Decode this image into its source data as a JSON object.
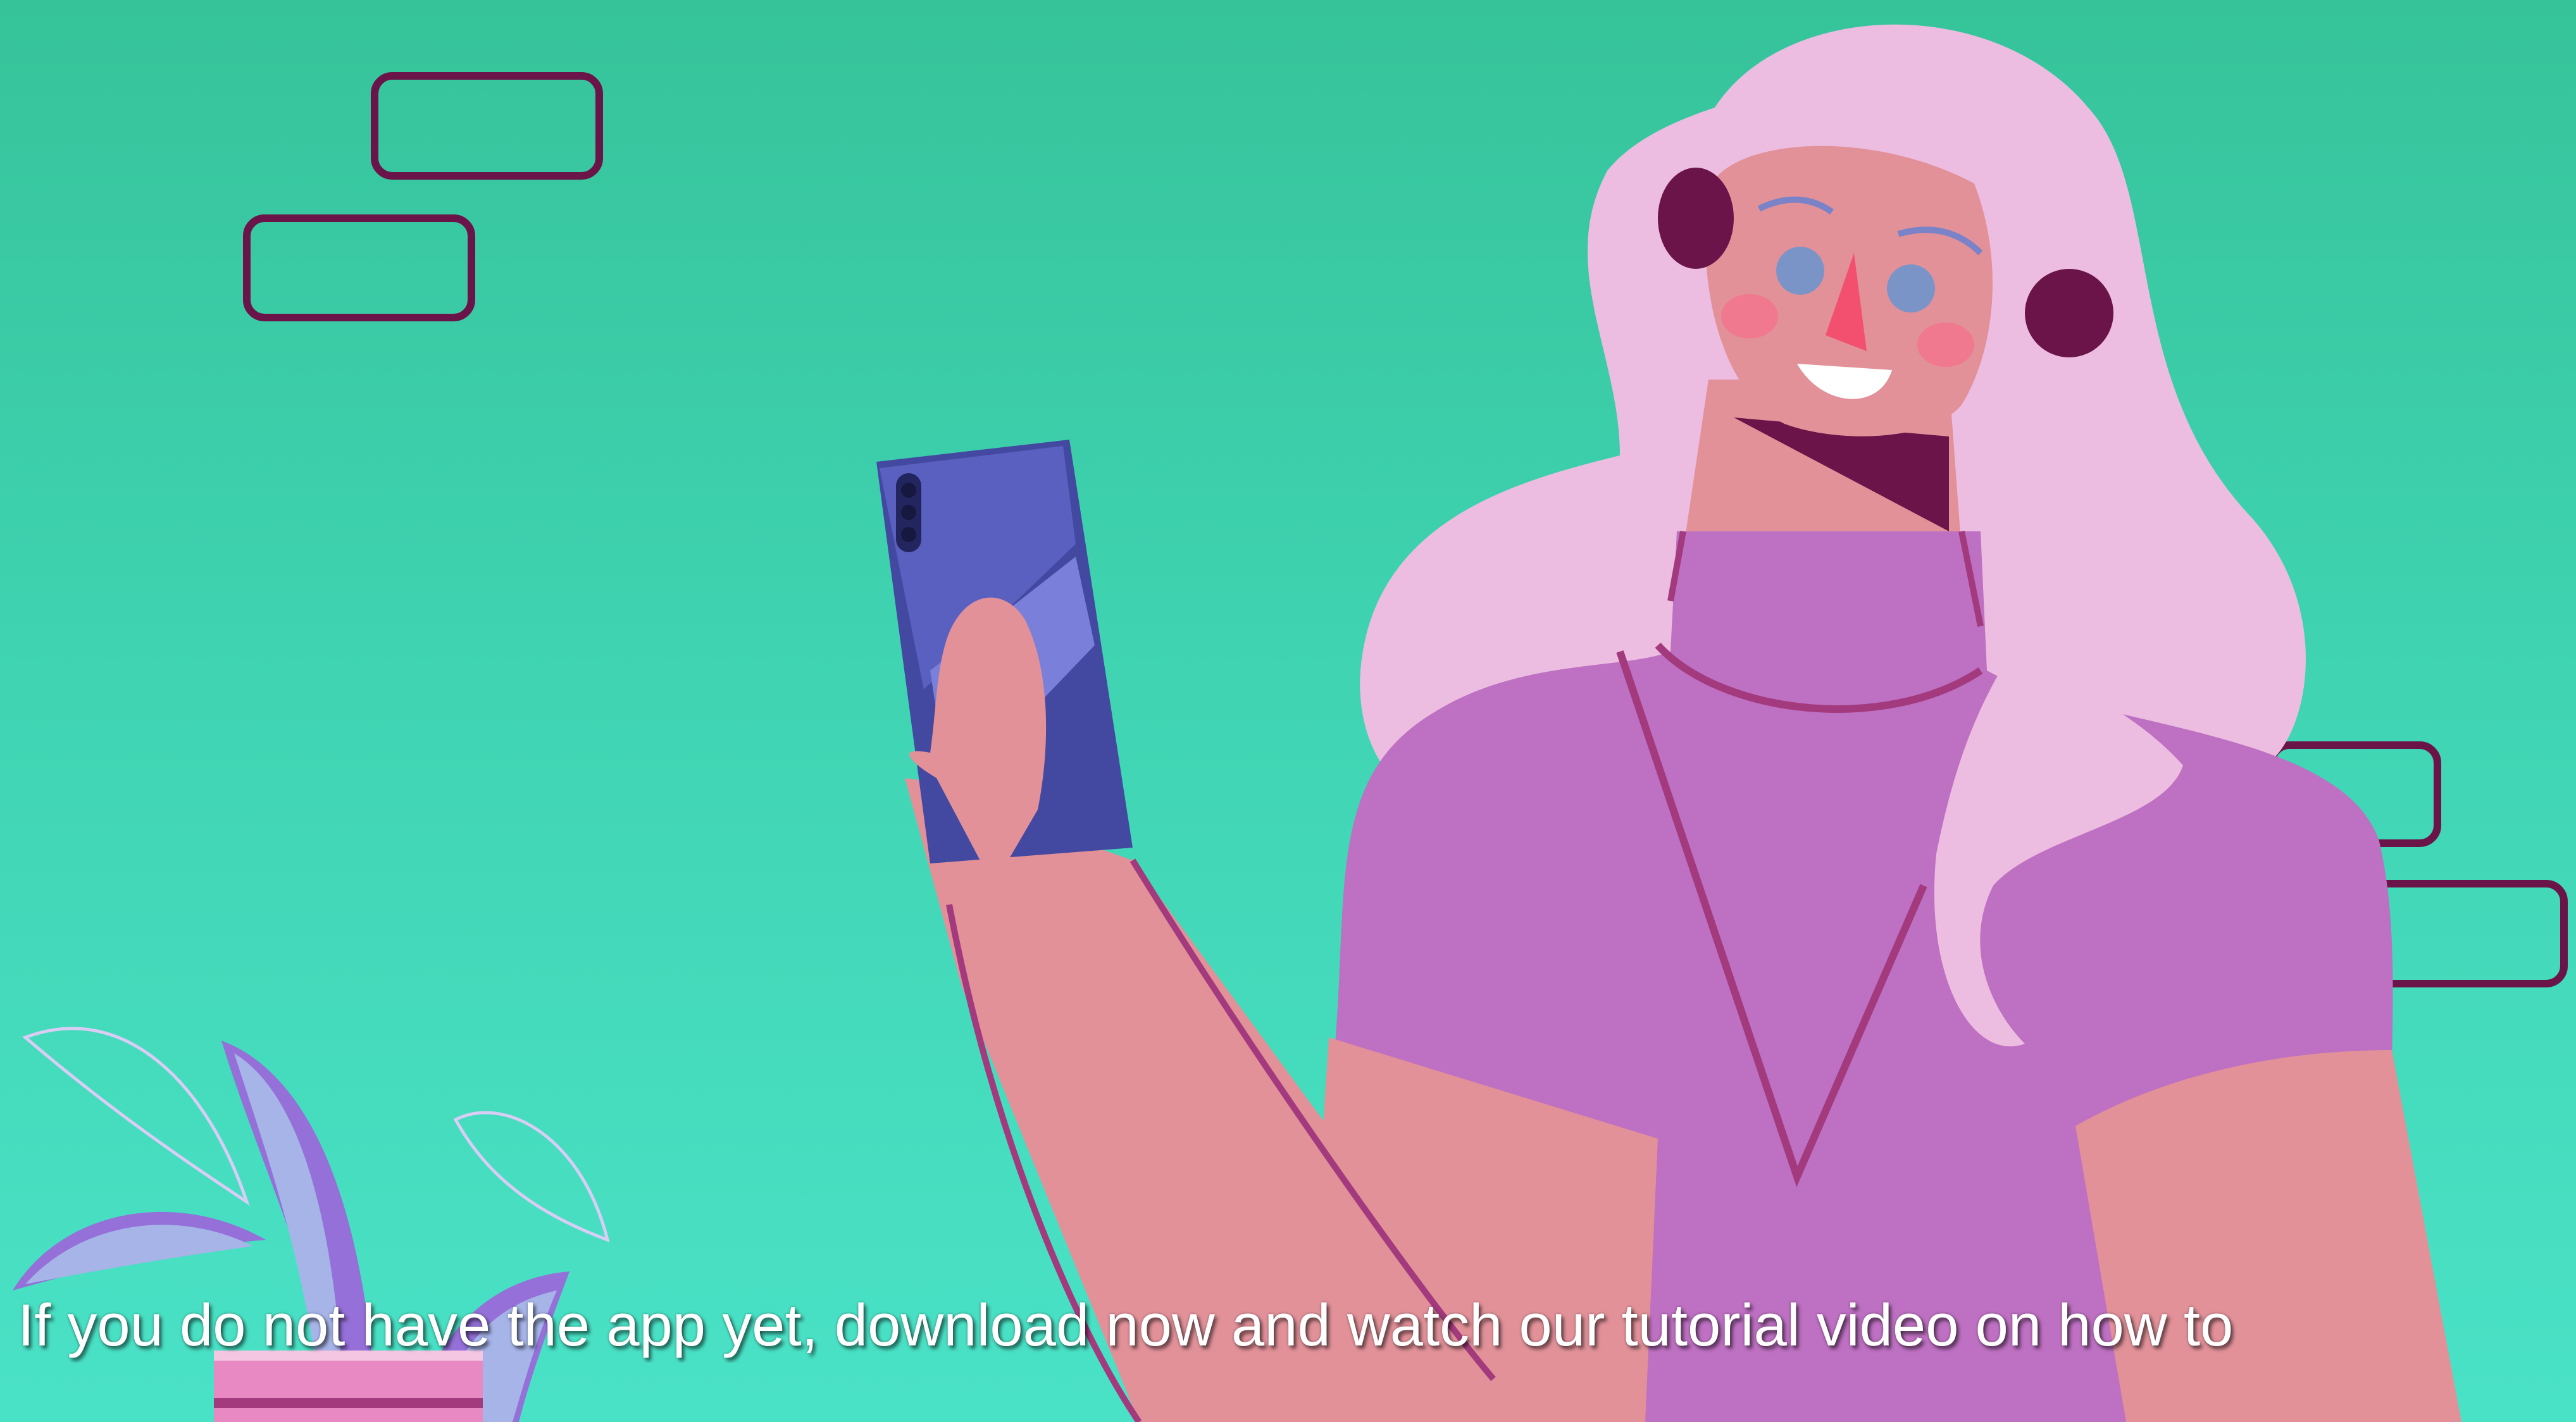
{
  "caption": {
    "text": "If you do not have the app yet, download now and watch our tutorial video on how to"
  },
  "colors": {
    "background_top": "#36c39a",
    "background_bottom": "#4ae2c7",
    "outline": "#6b1449",
    "hair": "#ecbde0",
    "skin": "#e29199",
    "shirt": "#be70c2",
    "phone": "#4348a0",
    "plant_leaf": "#9470d8",
    "pot": "#e889c4"
  }
}
